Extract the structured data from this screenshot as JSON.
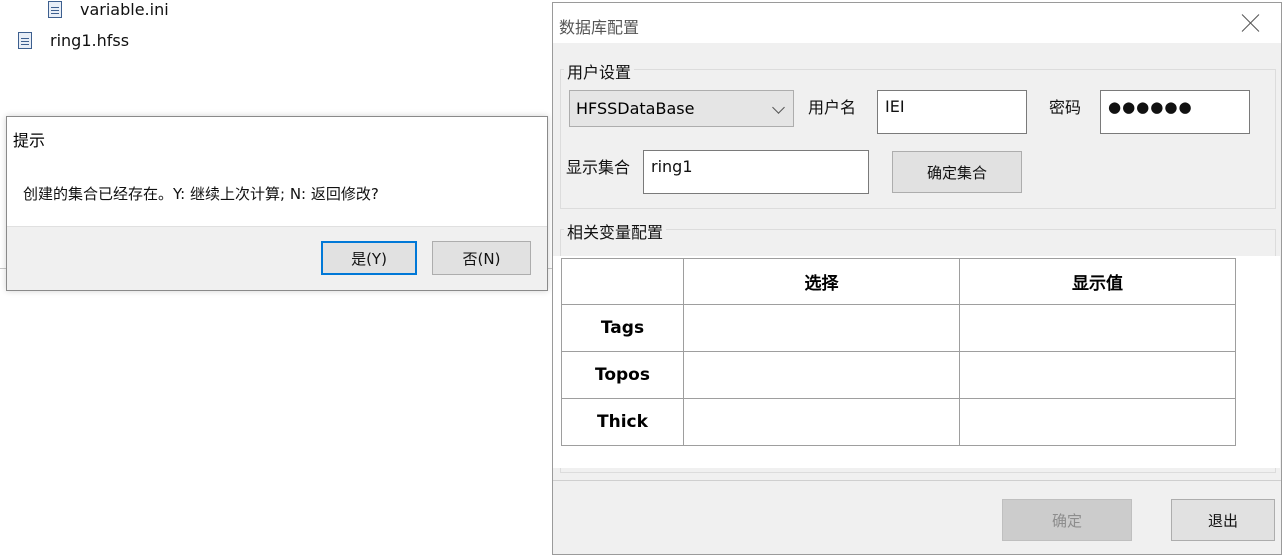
{
  "explorer": {
    "files": [
      {
        "name": "variable.ini",
        "icon": "ini-file-icon"
      },
      {
        "name": "ring1.hfss",
        "icon": "hfss-file-icon"
      }
    ]
  },
  "prompt_dialog": {
    "title": "提示",
    "message": "创建的集合已经存在。Y: 继续上次计算; N: 返回修改?",
    "yes_label": "是(Y)",
    "no_label": "否(N)"
  },
  "db_config": {
    "title": "数据库配置",
    "user_settings": {
      "group_label": "用户设置",
      "database_value": "HFSSDataBase",
      "username_label": "用户名",
      "username_value": "IEI",
      "password_label": "密码",
      "password_mask": "●●●●●●",
      "collection_label": "显示集合",
      "collection_value": "ring1",
      "confirm_collection_label": "确定集合"
    },
    "variables": {
      "group_label": "相关变量配置",
      "columns": [
        "",
        "选择",
        "显示值"
      ],
      "rows": [
        {
          "name": "Tags",
          "select": "",
          "display": ""
        },
        {
          "name": "Topos",
          "select": "",
          "display": ""
        },
        {
          "name": "Thick",
          "select": "",
          "display": ""
        }
      ]
    },
    "footer": {
      "ok_label": "确定",
      "exit_label": "退出"
    }
  }
}
